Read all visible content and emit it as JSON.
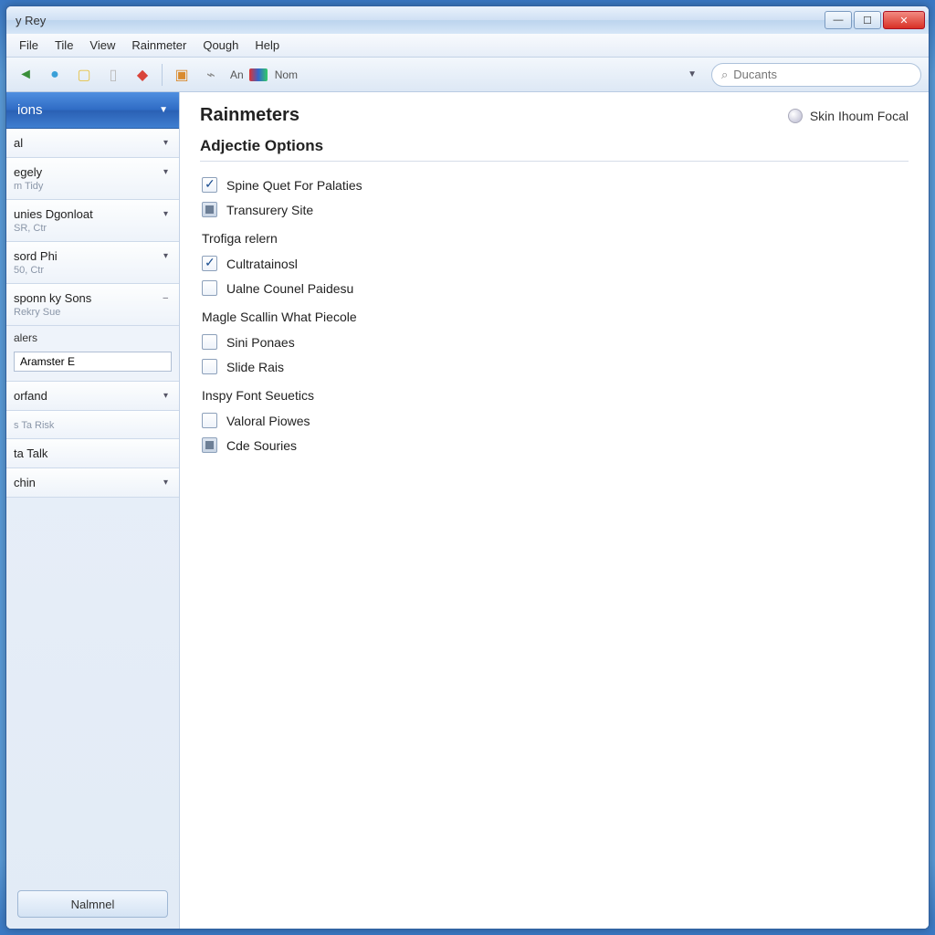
{
  "window": {
    "title": "y Rey"
  },
  "menu": {
    "items": [
      "File",
      "Tile",
      "View",
      "Rainmeter",
      "Qough",
      "Help"
    ]
  },
  "toolbar": {
    "icons": [
      {
        "name": "back-icon",
        "glyph": "◄",
        "color": "#3a8f3a"
      },
      {
        "name": "globe-icon",
        "glyph": "●",
        "color": "#3aa0d8"
      },
      {
        "name": "note-icon",
        "glyph": "▢",
        "color": "#e6c34a"
      },
      {
        "name": "page-icon",
        "glyph": "▯",
        "color": "#ddd"
      },
      {
        "name": "lock-icon",
        "glyph": "◆",
        "color": "#d9443a"
      }
    ],
    "icons2": [
      {
        "name": "folder-icon",
        "glyph": "▣",
        "color": "#d98b2f"
      },
      {
        "name": "edit-icon",
        "glyph": "⌁",
        "color": "#888"
      }
    ],
    "label1": "An",
    "colorSwatch": "cs",
    "label2": "Nom"
  },
  "search": {
    "placeholder": "Ducants"
  },
  "sidebar": {
    "header": "ions",
    "items": [
      {
        "title": "al",
        "sub": "",
        "caret": true
      },
      {
        "title": "egely",
        "sub": "m Tidy",
        "caret": true
      },
      {
        "title": "unies Dgonloat",
        "sub": "SR, Ctr",
        "caret": true
      },
      {
        "title": "sord Phi",
        "sub": "50, Ctr",
        "caret": true
      },
      {
        "title": "sponn ky Sons",
        "sub": "Rekry Sue",
        "caret": false
      }
    ],
    "inputLabel": "alers",
    "inputValue": "Aramster E",
    "items2": [
      {
        "title": "orfand",
        "sub": "",
        "caret": true
      },
      {
        "title": "",
        "sub": "s Ta Risk",
        "caret": false
      },
      {
        "title": "ta Talk",
        "sub": "",
        "caret": false
      },
      {
        "title": "chin",
        "sub": "",
        "caret": true
      }
    ],
    "button": "Nalmnel"
  },
  "main": {
    "title": "Rainmeters",
    "skin": "Skin Ihoum Focal",
    "sectionTitle": "Adjectie Options",
    "groups": [
      {
        "label": "",
        "opts": [
          {
            "label": "Spine Quet For Palaties",
            "state": "checked"
          },
          {
            "label": "Transurery Site",
            "state": "mixed"
          }
        ]
      },
      {
        "label": "Trofiga relern",
        "opts": [
          {
            "label": "Cultratainosl",
            "state": "checked"
          },
          {
            "label": "Ualne Counel Paidesu",
            "state": "unchecked"
          }
        ]
      },
      {
        "label": "Magle Scallin What Piecole",
        "opts": [
          {
            "label": "Sini Ponaes",
            "state": "unchecked"
          },
          {
            "label": "Slide Rais",
            "state": "unchecked"
          }
        ]
      },
      {
        "label": "Inspy Font Seuetics",
        "opts": [
          {
            "label": "Valoral Piowes",
            "state": "unchecked"
          },
          {
            "label": "Cde Souries",
            "state": "mixed"
          }
        ]
      }
    ]
  }
}
